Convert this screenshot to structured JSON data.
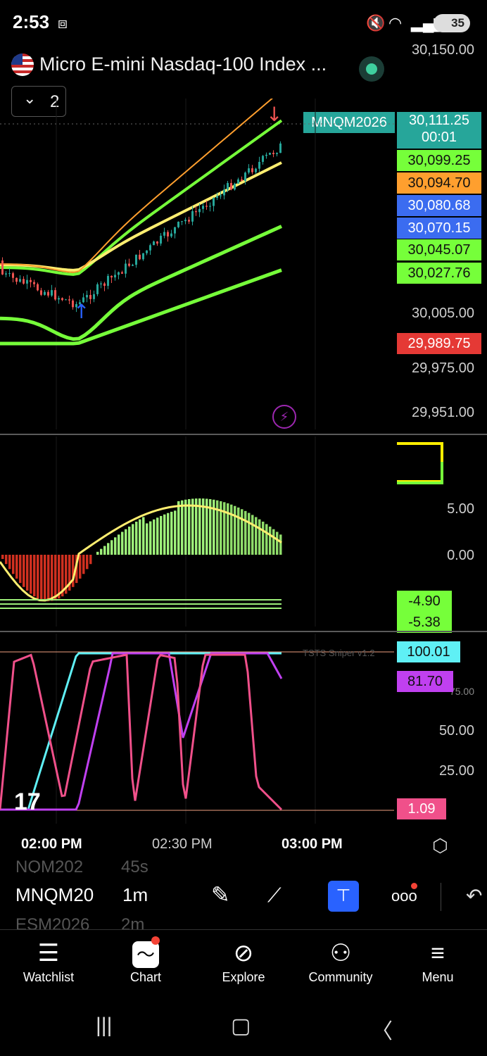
{
  "status_bar": {
    "time": "2:53",
    "battery": "35"
  },
  "header": {
    "title": "Micro E-mini Nasdaq-100 Index ...",
    "interval_value": "2"
  },
  "price_scale": {
    "top": "30,150.00",
    "symbol_tag": "MNQM2026",
    "last_price": "30,111.25",
    "countdown": "00:01",
    "tags": [
      {
        "value": "30,099.25",
        "color": "#76ff3a"
      },
      {
        "value": "30,094.70",
        "color": "#ff9f2e"
      },
      {
        "value": "30,080.68",
        "color": "#3b6cf0"
      },
      {
        "value": "30,070.15",
        "color": "#3b6cf0"
      },
      {
        "value": "30,045.07",
        "color": "#76ff3a"
      },
      {
        "value": "30,027.76",
        "color": "#76ff3a"
      }
    ],
    "labels": [
      "30,005.00",
      "29,975.00",
      "29,951.00"
    ],
    "low_tag": {
      "value": "29,989.75",
      "color": "#e53935"
    }
  },
  "macd_panel": {
    "labels": [
      "5.00",
      "0.00"
    ],
    "tags": [
      "-4.90",
      "-5.38"
    ]
  },
  "osc_panel": {
    "name": "TSTS Sniper v1.2",
    "labels": [
      "75.00",
      "50.00",
      "25.00"
    ],
    "tags": [
      {
        "value": "100.01",
        "color": "#5ff0f5"
      },
      {
        "value": "81.70",
        "color": "#c040f0"
      },
      {
        "value": "1.09",
        "color": "#f0508a"
      }
    ]
  },
  "time_axis": [
    "02:00 PM",
    "02:30 PM",
    "03:00 PM"
  ],
  "toolbar": {
    "symbol": "MNQM20",
    "interval": "1m",
    "ghost_above": "NQM202",
    "ghost_above_interval": "45s",
    "ghost_below": "ESM2026",
    "ghost_below_interval": "2m"
  },
  "bottom_nav": [
    "Watchlist",
    "Chart",
    "Explore",
    "Community",
    "Menu"
  ],
  "colors": {
    "up": "#26a69a",
    "down": "#ef5350",
    "green_line": "#76ff3a",
    "yellow_line": "#ffee70"
  }
}
